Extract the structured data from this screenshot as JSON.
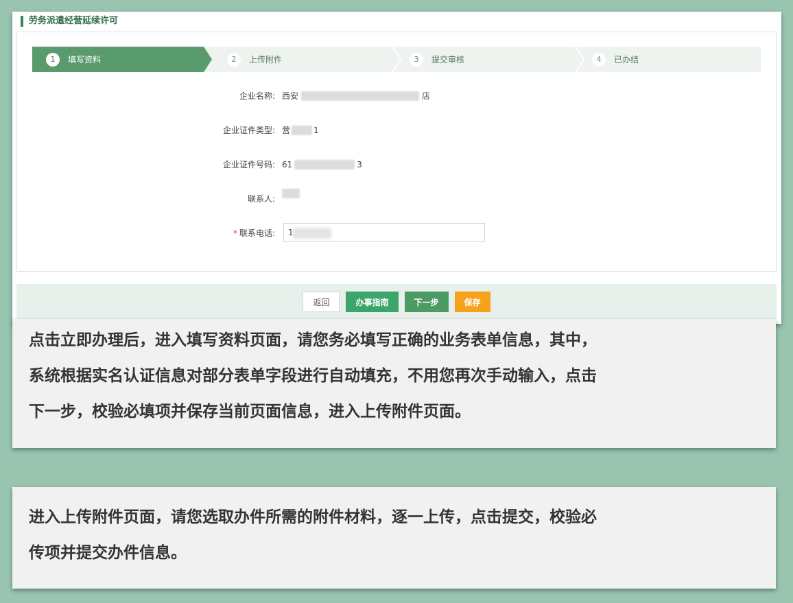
{
  "app": {
    "title": "劳务派遣经营延续许可"
  },
  "steps": [
    {
      "num": "1",
      "label": "填写资料",
      "active": true
    },
    {
      "num": "2",
      "label": "上传附件",
      "active": false
    },
    {
      "num": "3",
      "label": "提交审核",
      "active": false
    },
    {
      "num": "4",
      "label": "已办结",
      "active": false
    }
  ],
  "form": {
    "company_name": {
      "label": "企业名称:",
      "value_prefix": "西安",
      "value_suffix": "店"
    },
    "cert_type": {
      "label": "企业证件类型:",
      "value_prefix": "营",
      "value_suffix": "1"
    },
    "cert_number": {
      "label": "企业证件号码:",
      "value_prefix": "61",
      "value_suffix": "3"
    },
    "contact": {
      "label": "联系人:"
    },
    "phone": {
      "required_mark": "*",
      "label": "联系电话:",
      "value": "1"
    }
  },
  "buttons": {
    "back": "返回",
    "guide": "办事指南",
    "next": "下一步",
    "save": "保存"
  },
  "colors": {
    "active_step": "#5a9b6e",
    "guide_button": "#3aa66b",
    "next_button": "#4b9b63",
    "save_button": "#f7a21b",
    "page_background": "#98c4b0"
  },
  "notes": {
    "note1_line1": "点击立即办理后，进入填写资料页面，请您务必填写正确的业务表单信息，其中，",
    "note1_line2": "系统根据实名认证信息对部分表单字段进行自动填充，不用您再次手动输入，点击",
    "note1_line3": "下一步，校验必填项并保存当前页面信息，进入上传附件页面。",
    "note2_line1": "进入上传附件页面，请您选取办件所需的附件材料，逐一上传，点击提交，校验必",
    "note2_line2": "传项并提交办件信息。"
  }
}
